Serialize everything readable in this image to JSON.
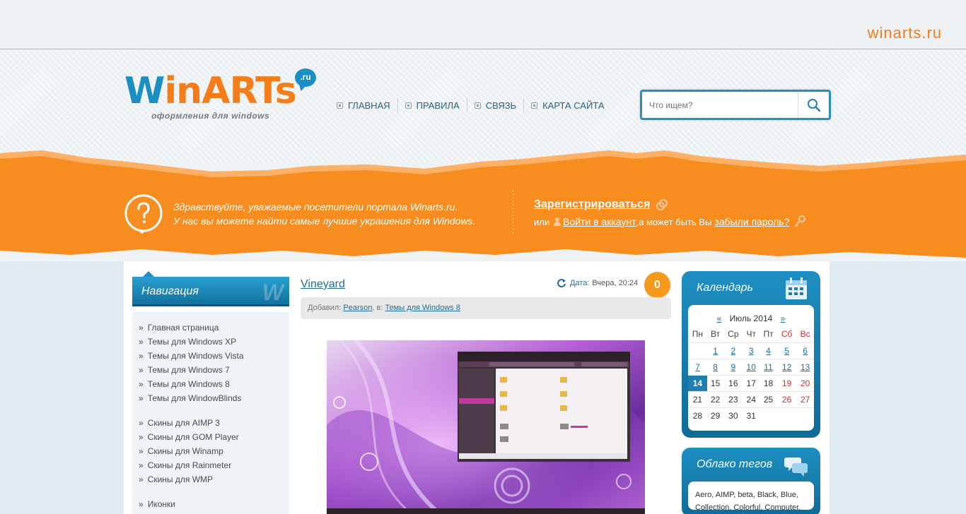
{
  "site": {
    "brand": "winarts.ru",
    "logo_w": "W",
    "logo_rest": "inARTs",
    "logo_ru": ".ru",
    "logo_tagline": "оформления для windows"
  },
  "topnav": [
    {
      "label": "ГЛАВНАЯ",
      "icon": "home-icon"
    },
    {
      "label": "ПРАВИЛА",
      "icon": "rules-icon"
    },
    {
      "label": "СВЯЗЬ",
      "icon": "contact-icon"
    },
    {
      "label": "КАРТА САЙТА",
      "icon": "sitemap-icon"
    }
  ],
  "search": {
    "placeholder": "Что ищем?"
  },
  "welcome": {
    "line1": "Здравствуйте, уважаемые посетители портала Winarts.ru.",
    "line2": "У нас вы можете найти самые лучшие украшения для Windows.",
    "register": "Зарегистрироваться",
    "or": "или",
    "login": "Войти в аккаунт",
    "maybe": ",а может быть Вы",
    "forgot": "забыли пароль?"
  },
  "sidebar": {
    "title": "Навигация",
    "watermark": "W",
    "groups": [
      [
        "Главная страница",
        "Темы для Windows XP",
        "Темы для Windows Vista",
        "Темы для Windows 7",
        "Темы для Windows 8",
        "Темы для WindowBlinds"
      ],
      [
        "Скины для AIMP 3",
        "Скины для GOM Player",
        "Скины для Winamp",
        "Скины для Rainmeter",
        "Скины для WMP"
      ],
      [
        "Иконки"
      ]
    ]
  },
  "post": {
    "title": "Vineyard",
    "date_label": "Дата:",
    "date_value": "Вчера, 20:24",
    "comments": "0",
    "added_by_label": "Добавил:",
    "author": "Pearson",
    "in_label": ", в:",
    "category": "Темы для Windows 8"
  },
  "calendar": {
    "title": "Календарь",
    "prev": "«",
    "month": "Июль 2014",
    "next": "»",
    "weekdays": [
      "Пн",
      "Вт",
      "Ср",
      "Чт",
      "Пт",
      "Сб",
      "Вс"
    ],
    "weeks": [
      [
        "",
        "1",
        "2",
        "3",
        "4",
        "5",
        "6"
      ],
      [
        "7",
        "8",
        "9",
        "10",
        "11",
        "12",
        "13"
      ],
      [
        "14",
        "15",
        "16",
        "17",
        "18",
        "19",
        "20"
      ],
      [
        "21",
        "22",
        "23",
        "24",
        "25",
        "26",
        "27"
      ],
      [
        "28",
        "29",
        "30",
        "31",
        "",
        "",
        ""
      ]
    ],
    "linked_days": [
      "1",
      "2",
      "3",
      "4",
      "5",
      "6",
      "7",
      "8",
      "9",
      "10",
      "11",
      "12",
      "13"
    ],
    "today": "14"
  },
  "tagcloud": {
    "title": "Облако тегов",
    "text": "Aero, AIMP, beta, Black, Blue, Collection, Colorful, Computer,"
  },
  "colors": {
    "accent_orange": "#f47d1a",
    "accent_blue": "#1b8fc4",
    "weekend_red": "#d03030"
  }
}
